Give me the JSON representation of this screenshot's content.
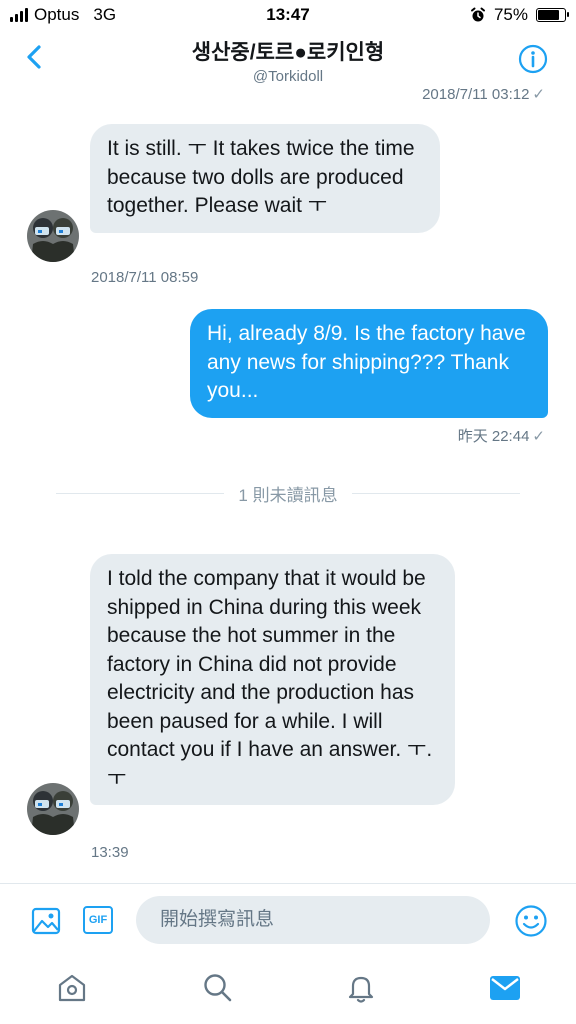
{
  "status": {
    "carrier": "Optus",
    "network": "3G",
    "time": "13:47",
    "battery": "75%",
    "battery_level": 0.75
  },
  "header": {
    "title": "생산중/토르●로키인형",
    "handle": "@Torkidoll"
  },
  "messages": {
    "top_timestamp": "2018/7/11 03:12",
    "m1_text": "It is still. ㅜ It takes twice the time because two dolls are produced together. Please wait ㅜ",
    "m1_time": "2018/7/11 08:59",
    "m2_text": "Hi, already 8/9. Is the factory have any news for shipping??? Thank you...",
    "m2_time": "昨天 22:44",
    "unread_divider": "1 則未讀訊息",
    "m3_text": "I told the company that it would be shipped in China during this week because the hot summer in the factory in China did not provide electricity and the production has been paused for a while. I will contact you if I have an answer. ㅜ.ㅜ",
    "m3_time": "13:39",
    "check": "✓"
  },
  "composer": {
    "placeholder": "開始撰寫訊息",
    "gif_label": "GIF"
  },
  "colors": {
    "accent": "#1da1f2",
    "bubble_received": "#e6ecf0",
    "meta_text": "#657786"
  }
}
